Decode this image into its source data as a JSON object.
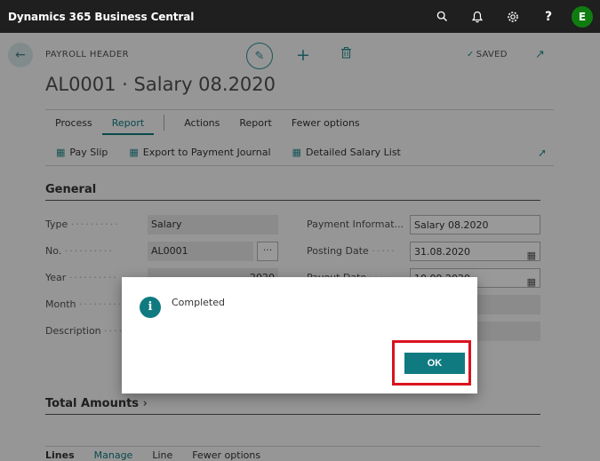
{
  "app": {
    "title": "Dynamics 365 Business Central",
    "avatar_initial": "E"
  },
  "topbar_icons": [
    "search-icon",
    "bell-icon",
    "gear-icon",
    "help-icon"
  ],
  "header": {
    "caption": "PAYROLL HEADER",
    "title": "AL0001 · Salary 08.2020",
    "saved_label": "SAVED"
  },
  "actions": {
    "process": "Process",
    "report": "Report",
    "actions": "Actions",
    "report2": "Report",
    "fewer": "Fewer options"
  },
  "reports": {
    "pay_slip": "Pay Slip",
    "export": "Export to Payment Journal",
    "detailed": "Detailed Salary List"
  },
  "general": {
    "section_title": "General",
    "type_label": "Type",
    "type_value": "Salary",
    "no_label": "No.",
    "no_value": "AL0001",
    "no_lookup": "···",
    "year_label": "Year",
    "year_value": "2020",
    "month_label": "Month",
    "description_label": "Description",
    "payment_info_label": "Payment Informat...",
    "payment_info_value": "Salary 08.2020",
    "posting_date_label": "Posting Date",
    "posting_date_value": "31.08.2020",
    "payout_date_label": "Payout Date",
    "payout_date_value": "10.09.2020"
  },
  "total_amounts": {
    "section_title": "Total Amounts"
  },
  "lines": {
    "lines": "Lines",
    "manage": "Manage",
    "line": "Line",
    "fewer": "Fewer options"
  },
  "dialog": {
    "message": "Completed",
    "ok_label": "OK"
  },
  "colors": {
    "accent": "#0f7b80",
    "highlight": "#d9121f",
    "topbar": "#1f1f1f"
  }
}
